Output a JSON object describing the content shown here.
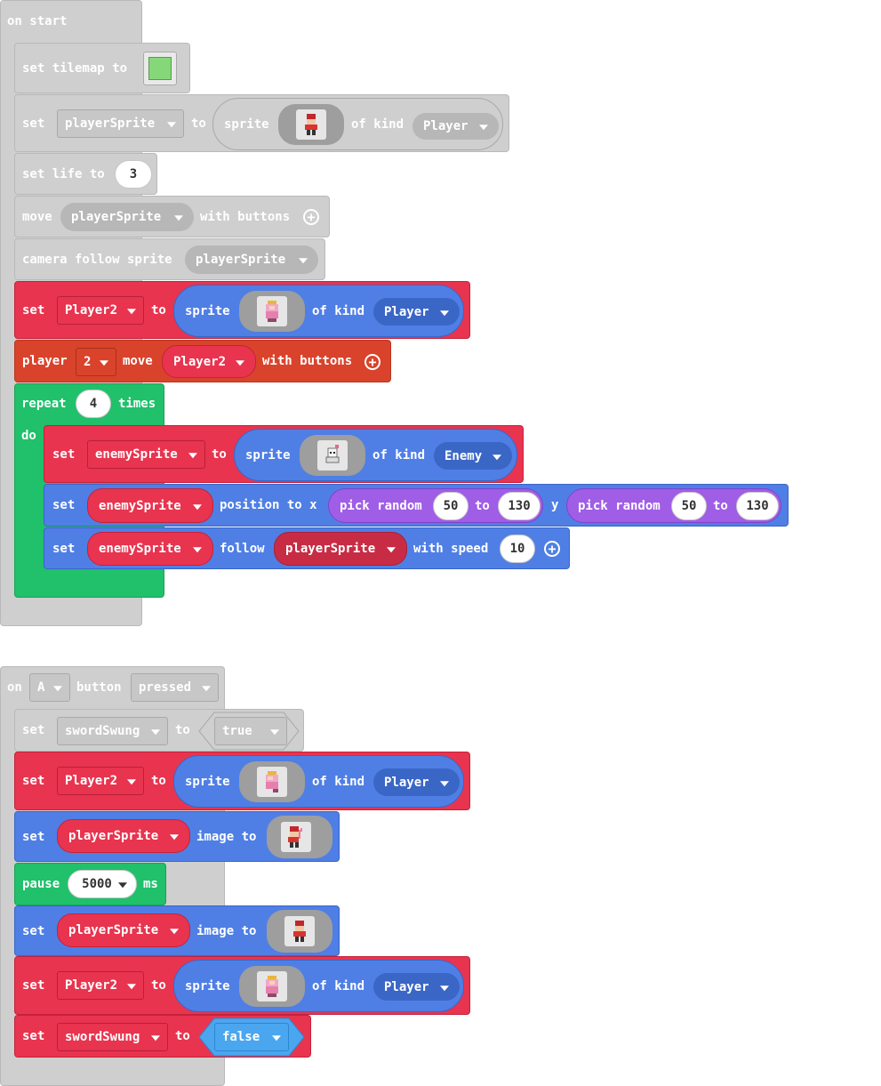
{
  "on_start": {
    "header": "on start",
    "set_tilemap": {
      "label": "set tilemap to"
    },
    "set_player": {
      "set": "set",
      "var": "playerSprite",
      "to": "to",
      "sprite": "sprite",
      "of_kind": "of kind",
      "kind": "Player"
    },
    "set_life": {
      "label": "set life to",
      "value": "3"
    },
    "move": {
      "move": "move",
      "var": "playerSprite",
      "with_buttons": "with buttons"
    },
    "camera": {
      "label": "camera follow sprite",
      "var": "playerSprite"
    },
    "set_player2": {
      "set": "set",
      "var": "Player2",
      "to": "to",
      "sprite": "sprite",
      "of_kind": "of kind",
      "kind": "Player"
    },
    "player_move": {
      "player": "player",
      "num": "2",
      "move": "move",
      "var": "Player2",
      "with_buttons": "with buttons"
    },
    "repeat": {
      "repeat": "repeat",
      "times_value": "4",
      "times": "times",
      "do": "do"
    },
    "set_enemy": {
      "set": "set",
      "var": "enemySprite",
      "to": "to",
      "sprite": "sprite",
      "of_kind": "of kind",
      "kind": "Enemy"
    },
    "set_pos": {
      "set": "set",
      "var": "enemySprite",
      "position_to_x": "position to x",
      "pick1": "pick random",
      "a1": "50",
      "to1": "to",
      "b1": "130",
      "y": "y",
      "pick2": "pick random",
      "a2": "50",
      "to2": "to",
      "b2": "130"
    },
    "set_follow": {
      "set": "set",
      "var": "enemySprite",
      "follow": "follow",
      "target": "playerSprite",
      "with_speed": "with speed",
      "speed": "10"
    }
  },
  "on_a": {
    "on": "on",
    "button_key": "A",
    "button": "button",
    "event": "pressed",
    "set_sword": {
      "set": "set",
      "var": "swordSwung",
      "to": "to",
      "value": "true"
    },
    "set_player2": {
      "set": "set",
      "var": "Player2",
      "to": "to",
      "sprite": "sprite",
      "of_kind": "of kind",
      "kind": "Player"
    },
    "set_image1": {
      "set": "set",
      "var": "playerSprite",
      "image_to": "image to"
    },
    "pause": {
      "pause": "pause",
      "value": "5000",
      "ms": "ms"
    },
    "set_image2": {
      "set": "set",
      "var": "playerSprite",
      "image_to": "image to"
    },
    "set_player2b": {
      "set": "set",
      "var": "Player2",
      "to": "to",
      "sprite": "sprite",
      "of_kind": "of kind",
      "kind": "Player"
    },
    "set_sword2": {
      "set": "set",
      "var": "swordSwung",
      "to": "to",
      "value": "false"
    }
  },
  "colors": {
    "gray": "#cfcfcf",
    "red": "#e8344f",
    "blue": "#4f7fe5",
    "green": "#21c06b",
    "orange": "#d9432b",
    "purple": "#a05de6",
    "light_blue": "#4aa6ef"
  },
  "icons": [
    "dropdown-caret-icon",
    "add-circle-icon",
    "tilemap-icon",
    "sprite-image-icon"
  ]
}
